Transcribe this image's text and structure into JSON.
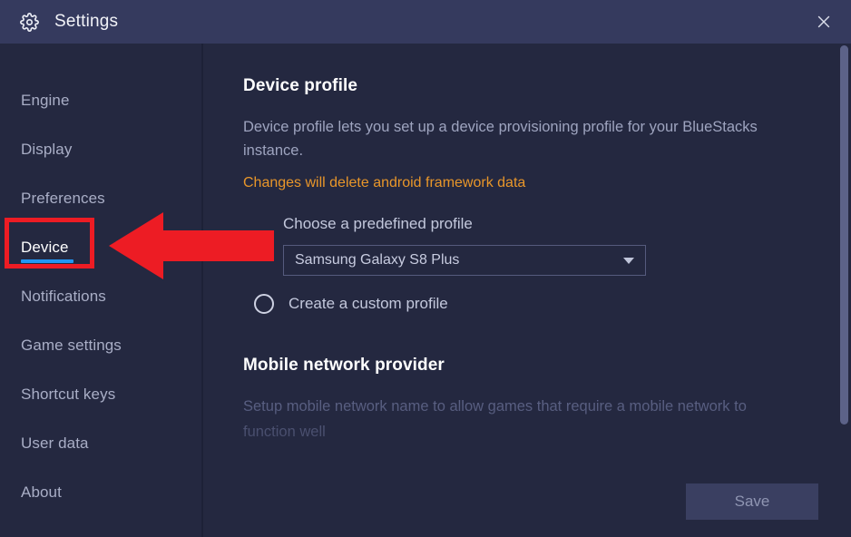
{
  "window": {
    "title": "Settings",
    "gear_icon": "gear-icon",
    "close_icon": "close-icon"
  },
  "sidebar": {
    "items": [
      {
        "label": "Engine",
        "active": false
      },
      {
        "label": "Display",
        "active": false
      },
      {
        "label": "Preferences",
        "active": false
      },
      {
        "label": "Device",
        "active": true
      },
      {
        "label": "Notifications",
        "active": false
      },
      {
        "label": "Game settings",
        "active": false
      },
      {
        "label": "Shortcut keys",
        "active": false
      },
      {
        "label": "User data",
        "active": false
      },
      {
        "label": "About",
        "active": false
      }
    ]
  },
  "main": {
    "device_profile": {
      "title": "Device profile",
      "description": "Device profile lets you set up a device provisioning profile for your BlueStacks instance.",
      "warning": "Changes will delete android framework data",
      "choose_label": "Choose a predefined profile",
      "selected_profile": "Samsung Galaxy S8 Plus",
      "caret_icon": "chevron-down-icon",
      "custom_profile_label": "Create a custom profile",
      "custom_profile_selected": false
    },
    "mobile_network": {
      "title": "Mobile network provider",
      "description": "Setup mobile network name to allow games that require a mobile network to function well"
    },
    "save_label": "Save"
  },
  "annotation": {
    "highlight_target": "Device",
    "arrow_direction": "left",
    "color": "#ed1c24"
  },
  "colors": {
    "titlebar_bg": "#353a5e",
    "body_bg": "#242840",
    "accent_underline": "#2196f3",
    "warning_text": "#e8962a",
    "annotation_red": "#ed1c24"
  }
}
